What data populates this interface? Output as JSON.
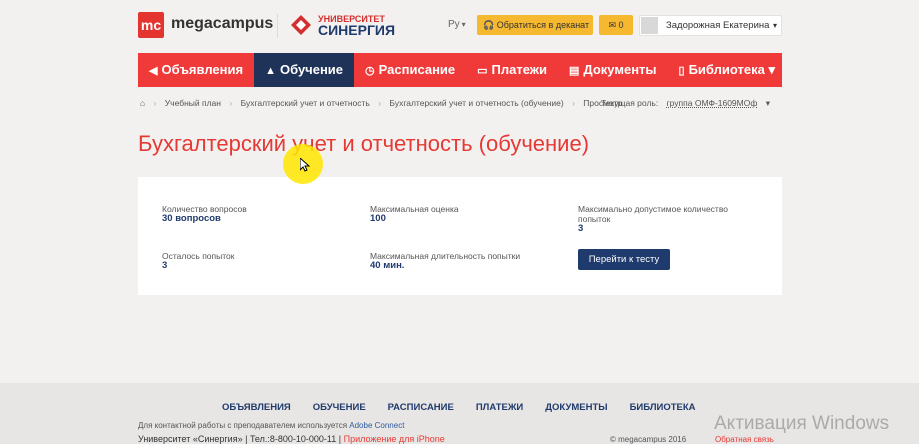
{
  "header": {
    "logo_badge": "mc",
    "logo_text": "megacampus",
    "synergy_line1": "УНИВЕРСИТЕТ",
    "synergy_line2": "СИНЕРГИЯ",
    "lang": "Ру",
    "dean_button": "Обратиться в деканат",
    "mail_count": "0",
    "user_name": "Задорожная Екатерина"
  },
  "nav": {
    "items": [
      {
        "label": "Объявления",
        "icon": "megaphone-icon"
      },
      {
        "label": "Обучение",
        "icon": "graduation-cap-icon"
      },
      {
        "label": "Расписание",
        "icon": "clock-icon"
      },
      {
        "label": "Платежи",
        "icon": "card-icon"
      },
      {
        "label": "Документы",
        "icon": "document-icon"
      },
      {
        "label": "Библиотека",
        "icon": "book-icon"
      }
    ],
    "active": "Обучение"
  },
  "breadcrumb": {
    "items": [
      "Учебный план",
      "Бухгалтерский учет и отчетность",
      "Бухгалтерский учет и отчетность (обучение)",
      "Просмотр"
    ],
    "role_label": "Текущая роль:",
    "role_value": "группа ОМФ-1609МОф"
  },
  "page": {
    "title": "Бухгалтерский учет и отчетность (обучение)"
  },
  "test_info": {
    "questions_label": "Количество вопросов",
    "questions_value": "30 вопросов",
    "max_score_label": "Максимальная оценка",
    "max_score_value": "100",
    "max_attempts_label": "Максимально допустимое количество попыток",
    "max_attempts_value": "3",
    "attempts_left_label": "Осталось попыток",
    "attempts_left_value": "3",
    "max_duration_label": "Максимальная длительность попытки",
    "max_duration_value": "40 мин.",
    "start_button": "Перейти к тесту"
  },
  "footer": {
    "nav": [
      "ОБЪЯВЛЕНИЯ",
      "ОБУЧЕНИЕ",
      "РАСПИСАНИЕ",
      "ПЛАТЕЖИ",
      "ДОКУМЕНТЫ",
      "БИБЛИОТЕКА"
    ],
    "contact_text": "Для контактной работы с преподавателем используется",
    "contact_link": "Adobe Connect",
    "university": "Университет «Синергия»",
    "phone": "Тел.:8-800-10-000-11",
    "app_link": "Приложение для iPhone",
    "copyright": "© megacampus 2016",
    "feedback": "Обратная связь"
  },
  "watermark": "Активация Windows",
  "colors": {
    "brand_red": "#f03a3a",
    "navy": "#1f3359",
    "yellow": "#f5b82e"
  }
}
